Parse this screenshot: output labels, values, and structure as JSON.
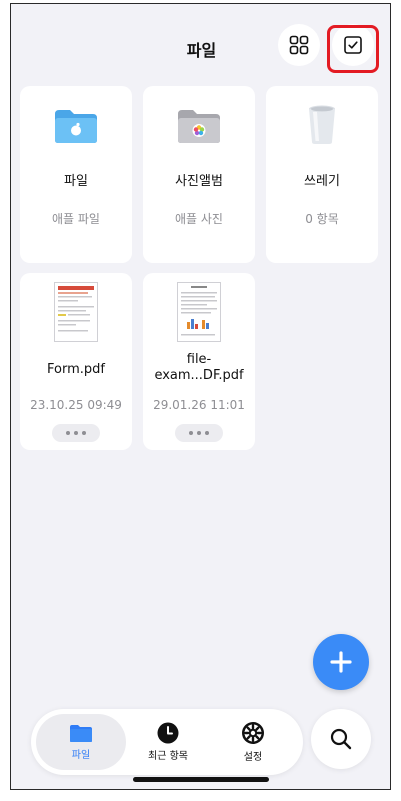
{
  "header": {
    "title": "파일"
  },
  "folders": [
    {
      "name": "파일",
      "subtitle": "애플 파일",
      "icon": "files-folder-icon"
    },
    {
      "name": "사진앨범",
      "subtitle": "애플 사진",
      "icon": "photos-folder-icon"
    },
    {
      "name": "쓰레기",
      "subtitle": "0 항목",
      "icon": "trash-icon"
    }
  ],
  "files": [
    {
      "name": "Form.pdf",
      "date": "23.10.25 09:49",
      "icon": "pdf-thumbnail-icon"
    },
    {
      "name": "file-exam...DF.pdf",
      "date": "29.01.26 11:01",
      "icon": "pdf-thumbnail-icon"
    }
  ],
  "tabs": [
    {
      "label": "파일",
      "icon": "folder-icon",
      "active": true
    },
    {
      "label": "최근 항목",
      "icon": "clock-icon",
      "active": false
    },
    {
      "label": "설정",
      "icon": "gear-icon",
      "active": false
    }
  ],
  "colors": {
    "accent": "#3a8bf7",
    "highlight": "#e31b23",
    "background": "#f2f2f7"
  }
}
